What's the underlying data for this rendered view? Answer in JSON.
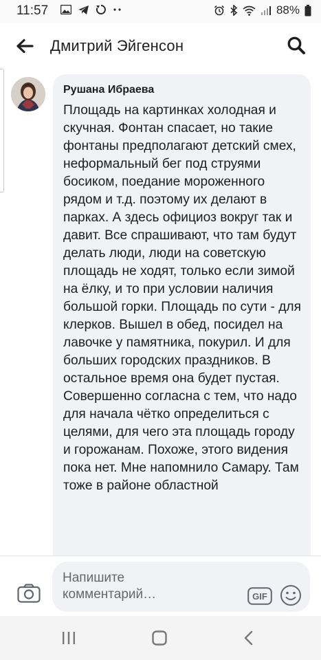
{
  "status_bar": {
    "time": "11:57",
    "battery_percent": "88%"
  },
  "header": {
    "title": "Дмитрий Эйгенсон"
  },
  "comment": {
    "author": "Рушана Ибраева",
    "text": "Площадь на картинках холодная и скучная. Фонтан спасает, но такие фонтаны предполагают детский смех, неформальный бег под струями босиком, поедание мороженного рядом и т.д. поэтому их делают в парках. А здесь официоз вокруг так и давит. Все спрашивают, что там будут делать люди, люди на советскую площадь не ходят, только если зимой на ёлку, и то при условии наличия большой горки. Площадь по сути - для клерков. Вышел в обед, посидел на лавочке у памятника, покурил. И для больших городских праздников. В остальное время она будет пустая. Совершенно согласна с тем, что надо для начала чётко определиться с целями, для чего эта площадь городу и горожанам. Похоже, этого видения пока нет. Мне напомнило Самару. Там тоже в районе областной"
  },
  "composer": {
    "placeholder": "Напишите комментарий…",
    "gif_label": "GIF"
  },
  "icons": {
    "back": "arrow-left-icon",
    "search": "search-icon",
    "camera": "camera-icon",
    "emoji": "smiley-icon",
    "nav_recents": "recents-icon",
    "nav_home": "home-icon",
    "nav_back": "chevron-left-icon"
  },
  "colors": {
    "bubble": "#f0f2f5",
    "text": "#1c1e21",
    "placeholder": "#65676b"
  }
}
